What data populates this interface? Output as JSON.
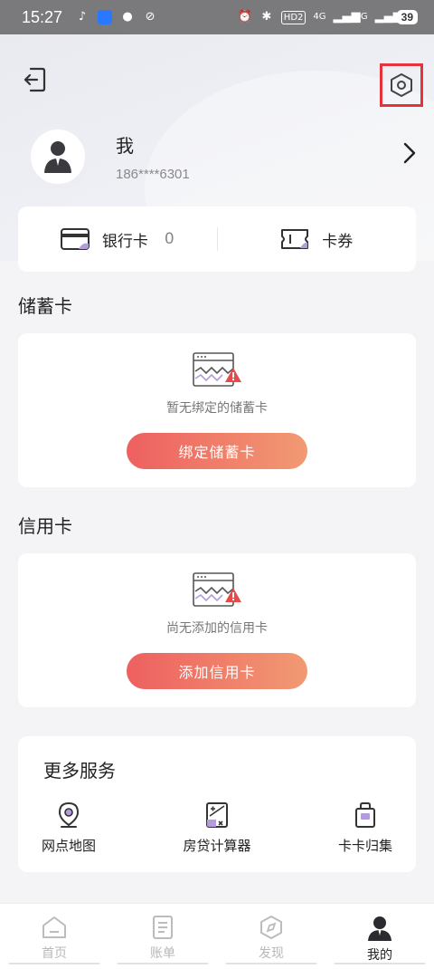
{
  "status_bar": {
    "time": "15:27",
    "network_badge": "HD2",
    "signal_4g": "4G",
    "signal_5g": "5G",
    "battery": "39"
  },
  "header": {
    "back_icon": "exit-icon",
    "settings_icon": "settings-hex-icon",
    "highlight_color": "#e5323b"
  },
  "profile": {
    "name": "我",
    "phone": "186****6301"
  },
  "quick": {
    "bank_card_label": "银行卡",
    "bank_card_count": "0",
    "coupon_label": "卡券"
  },
  "debit": {
    "title": "储蓄卡",
    "empty_text": "暂无绑定的储蓄卡",
    "button": "绑定储蓄卡"
  },
  "credit": {
    "title": "信用卡",
    "empty_text": "尚无添加的信用卡",
    "button": "添加信用卡"
  },
  "more": {
    "title": "更多服务",
    "items": [
      {
        "label": "网点地图",
        "icon": "map-pin-icon"
      },
      {
        "label": "房贷计算器",
        "icon": "calculator-icon"
      },
      {
        "label": "卡卡归集",
        "icon": "card-bag-icon"
      }
    ]
  },
  "nav": {
    "items": [
      {
        "label": "首页",
        "icon": "home-icon",
        "active": false
      },
      {
        "label": "账单",
        "icon": "bill-icon",
        "active": false
      },
      {
        "label": "发现",
        "icon": "compass-icon",
        "active": false
      },
      {
        "label": "我的",
        "icon": "user-icon",
        "active": true
      }
    ]
  },
  "colors": {
    "accent_start": "#ee6060",
    "accent_end": "#f19a73",
    "warning": "#e64b4b"
  }
}
